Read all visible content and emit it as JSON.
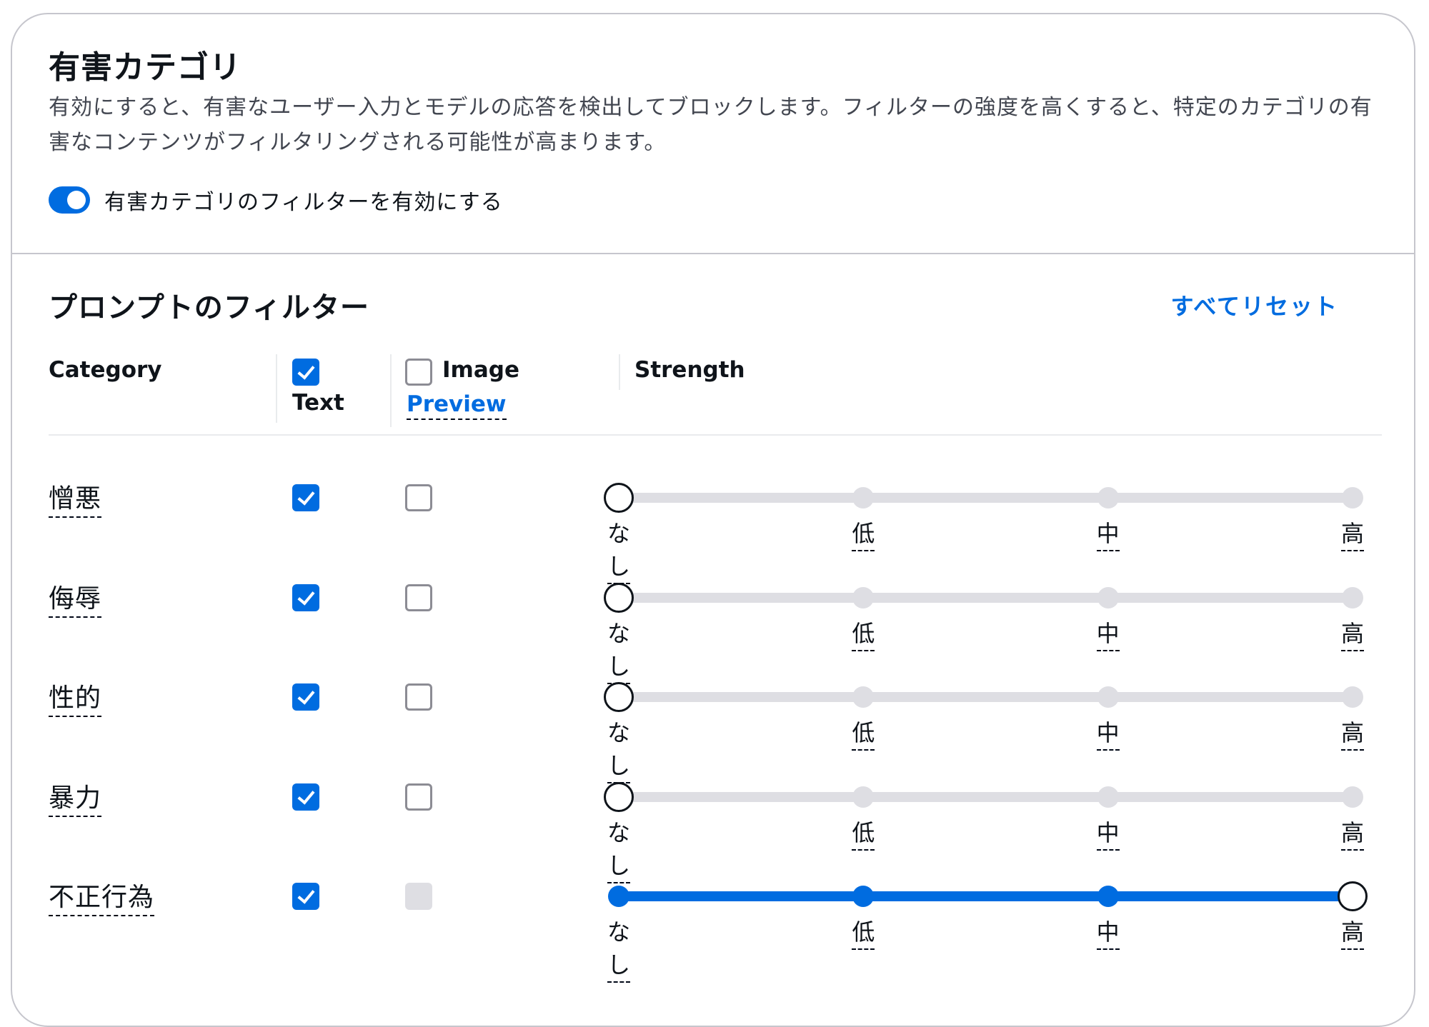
{
  "section": {
    "title": "有害カテゴリ",
    "description": "有効にすると、有害なユーザー入力とモデルの応答を検出してブロックします。フィルターの強度を高くすると、特定のカテゴリの有害なコンテンツがフィルタリングされる可能性が高まります。",
    "toggle": {
      "label": "有害カテゴリのフィルターを有効にする",
      "enabled": true
    }
  },
  "prompt_filters": {
    "title": "プロンプトのフィルター",
    "reset_label": "すべてリセット",
    "columns": {
      "category": "Category",
      "text": {
        "label": "Text",
        "checked": true
      },
      "image": {
        "label": "Image",
        "checked": false,
        "preview_label": "Preview"
      },
      "strength": "Strength"
    },
    "levels": [
      "なし",
      "低",
      "中",
      "高"
    ],
    "rows": [
      {
        "category": "憎悪",
        "text": true,
        "image": "unchecked",
        "strength_index": 0
      },
      {
        "category": "侮辱",
        "text": true,
        "image": "unchecked",
        "strength_index": 0
      },
      {
        "category": "性的",
        "text": true,
        "image": "unchecked",
        "strength_index": 0
      },
      {
        "category": "暴力",
        "text": true,
        "image": "unchecked",
        "strength_index": 0
      },
      {
        "category": "不正行為",
        "text": true,
        "image": "disabled",
        "strength_index": 3
      }
    ]
  },
  "colors": {
    "accent": "#006ce0",
    "track": "#dedee3",
    "text": "#0f141a",
    "muted": "#424650"
  }
}
